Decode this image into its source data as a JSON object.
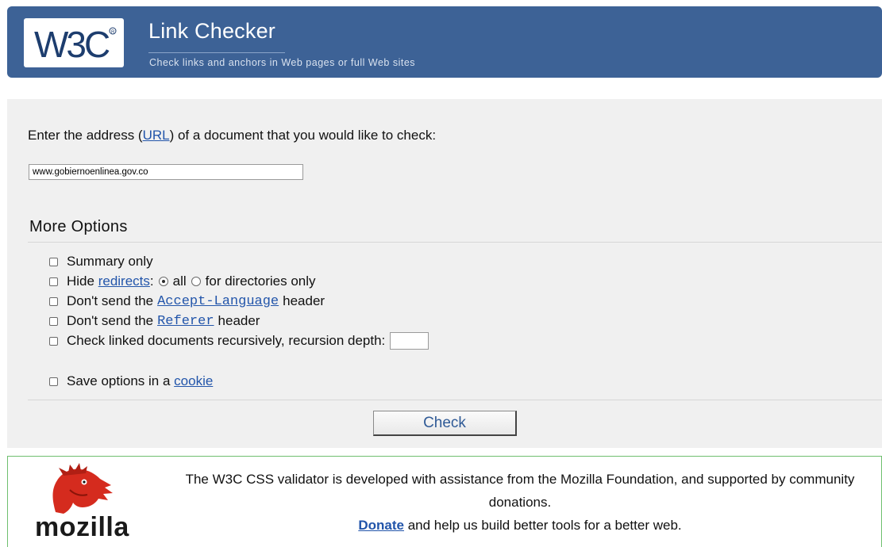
{
  "header": {
    "logo_text": "W3C",
    "title": "Link Checker",
    "subtitle": "Check links and anchors in Web pages or full Web sites"
  },
  "form": {
    "prompt_before": "Enter the address (",
    "prompt_link": "URL",
    "prompt_after": ") of a document that you would like to check:",
    "url_value": "www.gobiernoenlinea.gov.co"
  },
  "options": {
    "heading": "More Options",
    "summary_only": "Summary only",
    "hide_prefix": "Hide",
    "redirects_link": "redirects",
    "hide_colon": ":",
    "radio_all": "all",
    "radio_dirs": "for directories only",
    "accept_prefix": "Don't send the",
    "accept_link": "Accept-Language",
    "accept_suffix": "header",
    "referer_prefix": "Don't send the",
    "referer_link": "Referer",
    "referer_suffix": "header",
    "recursive": "Check linked documents recursively, recursion depth:",
    "cookie_prefix": "Save options in a",
    "cookie_link": "cookie"
  },
  "check_button": "Check",
  "support": {
    "logo_word": "mozilla",
    "line1": "The W3C CSS validator is developed with assistance from the Mozilla Foundation, and supported by community donations.",
    "donate_link": "Donate",
    "line2_rest": " and help us build better tools for a better web."
  },
  "colors": {
    "header_bg": "#3d6296",
    "panel_bg": "#f0f0f0",
    "link": "#2255aa",
    "support_border": "#6fbf6f",
    "mozilla_red": "#d52b1e"
  }
}
